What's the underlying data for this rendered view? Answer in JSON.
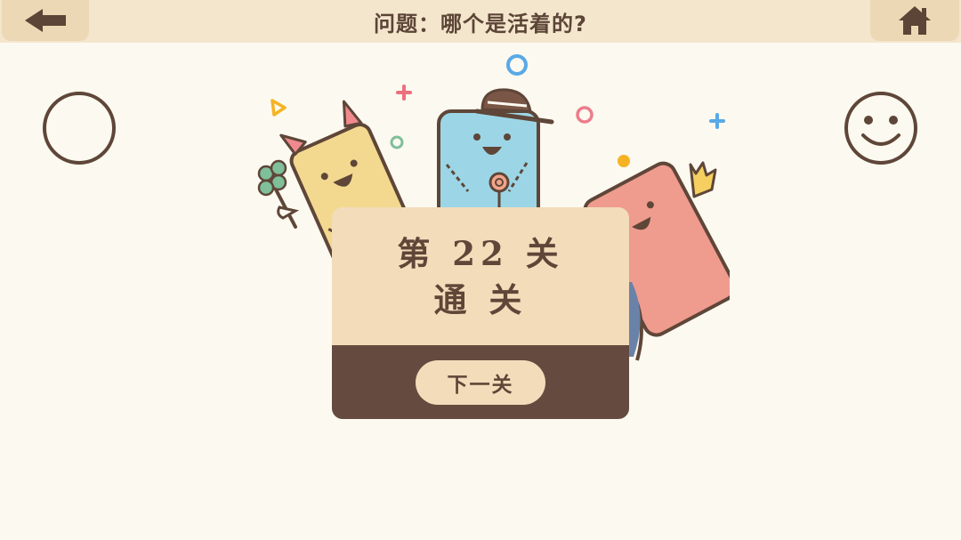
{
  "header": {
    "title": "问题：哪个是活着的?",
    "back_icon": "arrow-left-icon",
    "home_icon": "home-icon"
  },
  "side_icons": {
    "left": "circle-icon",
    "right": "smiley-face-icon"
  },
  "dialog": {
    "level_text": "第 22 关",
    "status_text": "通 关",
    "next_button_label": "下一关"
  },
  "colors": {
    "background": "#fcf9f0",
    "top_bar": "#f4e6cd",
    "brown": "#5e4638",
    "panel_light": "#f2dcba",
    "panel_dark": "#654b3f",
    "yellow_character": "#f3d98f",
    "blue_character": "#9cd6e6",
    "red_character": "#ef9b8e"
  }
}
